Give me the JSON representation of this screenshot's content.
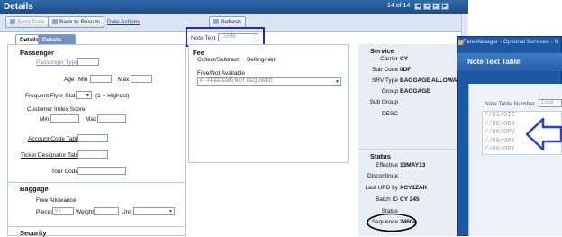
{
  "header": {
    "title": "Details",
    "page_info": "14 of 14",
    "nav": [
      "first",
      "prev",
      "next",
      "last"
    ]
  },
  "toolbar": {
    "save_label": "Save Date",
    "back_label": "Back to Results",
    "date_actions": "Date Actions",
    "refresh_label": "Refresh"
  },
  "note_text": {
    "label": "Note Text",
    "value": "15596"
  },
  "tabs": [
    {
      "label": "Details"
    },
    {
      "label": "Details Continued"
    }
  ],
  "passenger": {
    "title": "Passenger",
    "type_label": "Passenger Type",
    "age_label": "Age",
    "min_label": "Min",
    "max_label": "Max",
    "ffs_label": "Frequent Flyer Status",
    "ffs_hint": "(1 = Highest)",
    "cis_label": "Customer Index Score",
    "cis_min": "Min",
    "cis_max": "Max",
    "account_link": "Account Code Table",
    "ticket_link": "Ticket Designator Table",
    "tour_label": "Tour Code"
  },
  "baggage": {
    "title": "Baggage",
    "free_allowance": "Free Allowance",
    "pieces_label": "Pieces",
    "pieces_value": "01",
    "weight_label": "Weight",
    "unit_label": "Unit"
  },
  "security": {
    "title": "Security"
  },
  "fee": {
    "title": "Fee",
    "collect_label": "Collect/Subtract",
    "selling_label": "Selling/Net",
    "free_label": "Free/Not Available",
    "free_value": "F - FREE-EMD NOT REQUIRED"
  },
  "service": {
    "title": "Service",
    "carrier_label": "Carrier",
    "carrier_value": "CY",
    "subcode_label": "Sub Code",
    "subcode_value": "0DF",
    "srv_label": "SRV Type",
    "srv_value": "BAGGAGE ALLOWA",
    "group_label": "Group",
    "group_value": "BAGGAGE",
    "subgroup_label": "Sub Group",
    "desc_label": "DESC"
  },
  "status": {
    "title": "Status",
    "effective_label": "Effective",
    "effective_value": "13MAY13",
    "discontinue_label": "Discontinue",
    "upd_label": "Last UPD by",
    "upd_value": "XCY1ZAK",
    "batch_label": "Batch ID",
    "batch_value": "CY 245",
    "status_label": "Status",
    "sequence_label": "Sequence",
    "sequence_value": "24604"
  },
  "fare_manager": {
    "window_title": "FareManager - Optional Services - N",
    "dialog_title": "Note Text Table",
    "number_label": "Note Table Number",
    "number_value": "1559",
    "lines": [
      "//01/0IZ",
      "//00/0D4",
      "//00/0PV",
      "//00/0PX",
      "//00/0PY"
    ]
  },
  "colors": {
    "title_bar": "#1d4d86",
    "highlight_box": "#2727c8",
    "arrow": "#2e3fd0",
    "ellipse": "#000000"
  }
}
